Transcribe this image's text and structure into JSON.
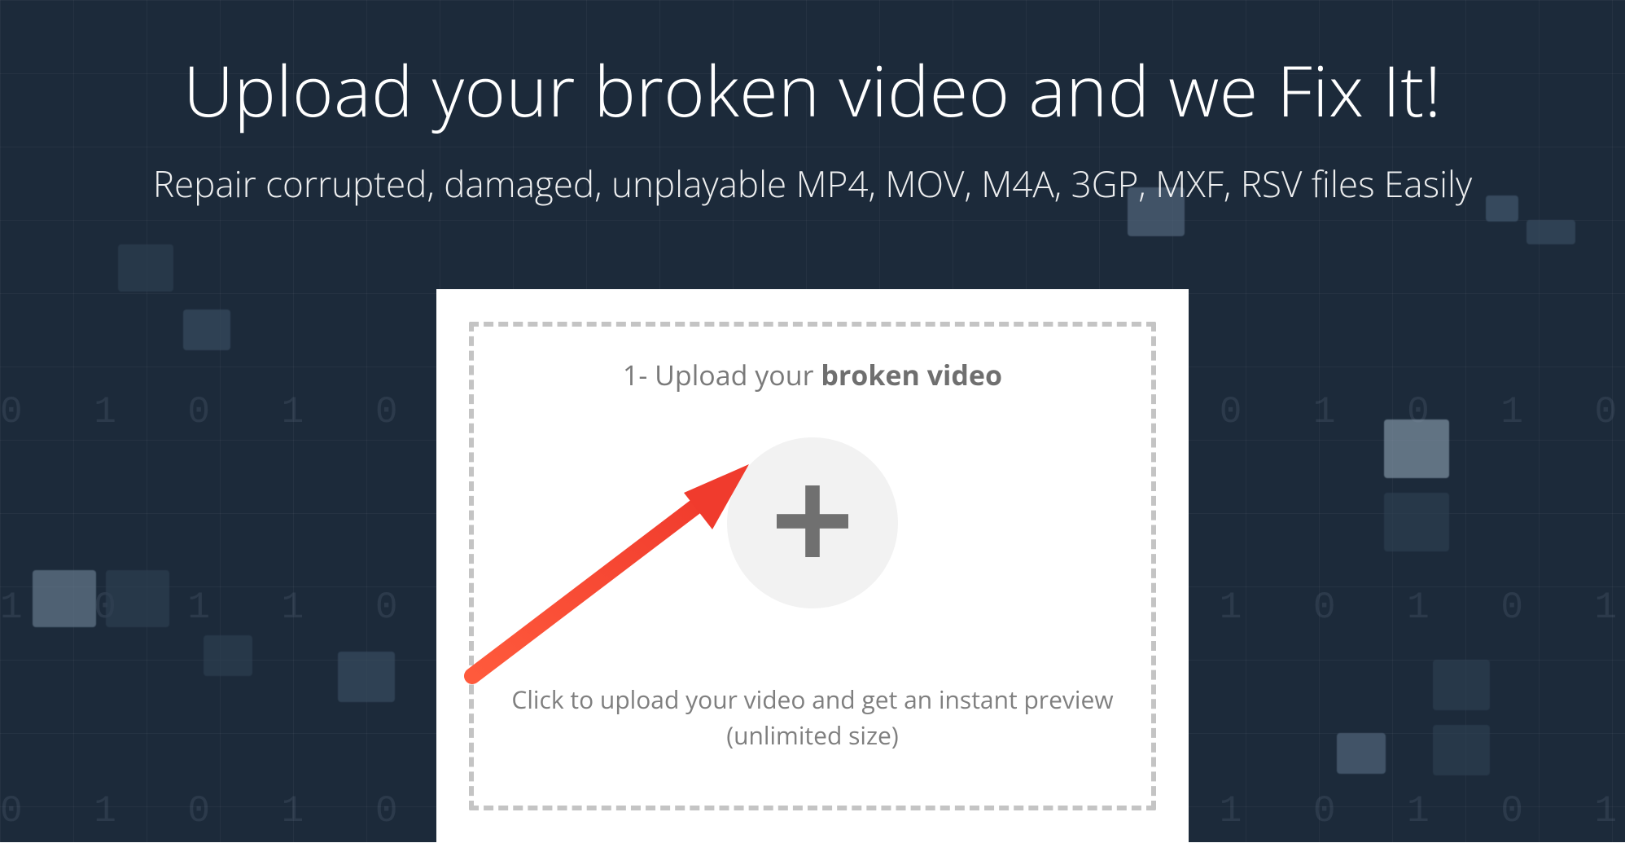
{
  "hero": {
    "title": "Upload your broken video and we Fix It!",
    "subtitle": "Repair corrupted, damaged, unplayable MP4, MOV, M4A, 3GP, MXF, RSV files Easily"
  },
  "upload": {
    "step_prefix": "1- Upload your ",
    "step_bold": "broken video",
    "instruction_line1": "Click to upload your video and get an instant preview",
    "instruction_line2": "(unlimited size)"
  }
}
